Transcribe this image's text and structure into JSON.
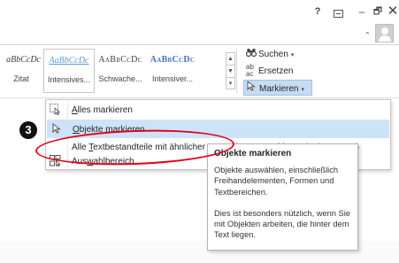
{
  "window": {
    "help_label": "?",
    "minimize_label": "–",
    "restore_label": "🗗",
    "close_label": "✕",
    "collapse_label": "⌃"
  },
  "ribbon": {
    "styles": [
      {
        "sample": "aBbCcDc",
        "name": "Zitat"
      },
      {
        "sample": "AaBbCcDc",
        "name": "Intensives..."
      },
      {
        "sample": "AaBbCcDc",
        "name": "Schwache..."
      },
      {
        "sample": "AaBbCcDc",
        "name": "Intensiver..."
      }
    ],
    "scroll_up": "▲",
    "scroll_down": "▼",
    "scroll_more": "▾",
    "search_label": "Suchen",
    "replace_label": "Ersetzen",
    "select_label": "Markieren",
    "caret": "▾"
  },
  "annotation": {
    "step_number": "3"
  },
  "menu": {
    "items": [
      {
        "label_pre": "",
        "label_u": "A",
        "label_post": "lles markieren",
        "icon": "select-all-icon"
      },
      {
        "label_pre": "",
        "label_u": "O",
        "label_post": "bjekte markieren",
        "icon": "cursor-arrow-icon"
      },
      {
        "label_pre": "Alle ",
        "label_u": "T",
        "label_post": "extbestandteile mit ähnlicher Formatierung markieren (Keine Daten)",
        "icon": ""
      },
      {
        "label_pre": "Aus",
        "label_u": "w",
        "label_post": "ahlbereich...",
        "icon": "selection-pane-icon"
      }
    ]
  },
  "tooltip": {
    "title": "Objekte markieren",
    "paragraph1": "Objekte auswählen, einschließlich Freihandelementen, Formen und Textbereichen.",
    "paragraph2": "Dies ist besonders nützlich, wenn Sie mit Objekten arbeiten, die hinter dem Text liegen."
  },
  "colors": {
    "highlight": "#cde3f8",
    "annotation_red": "#e3001b",
    "markieren_active": "#c5dcf2"
  }
}
